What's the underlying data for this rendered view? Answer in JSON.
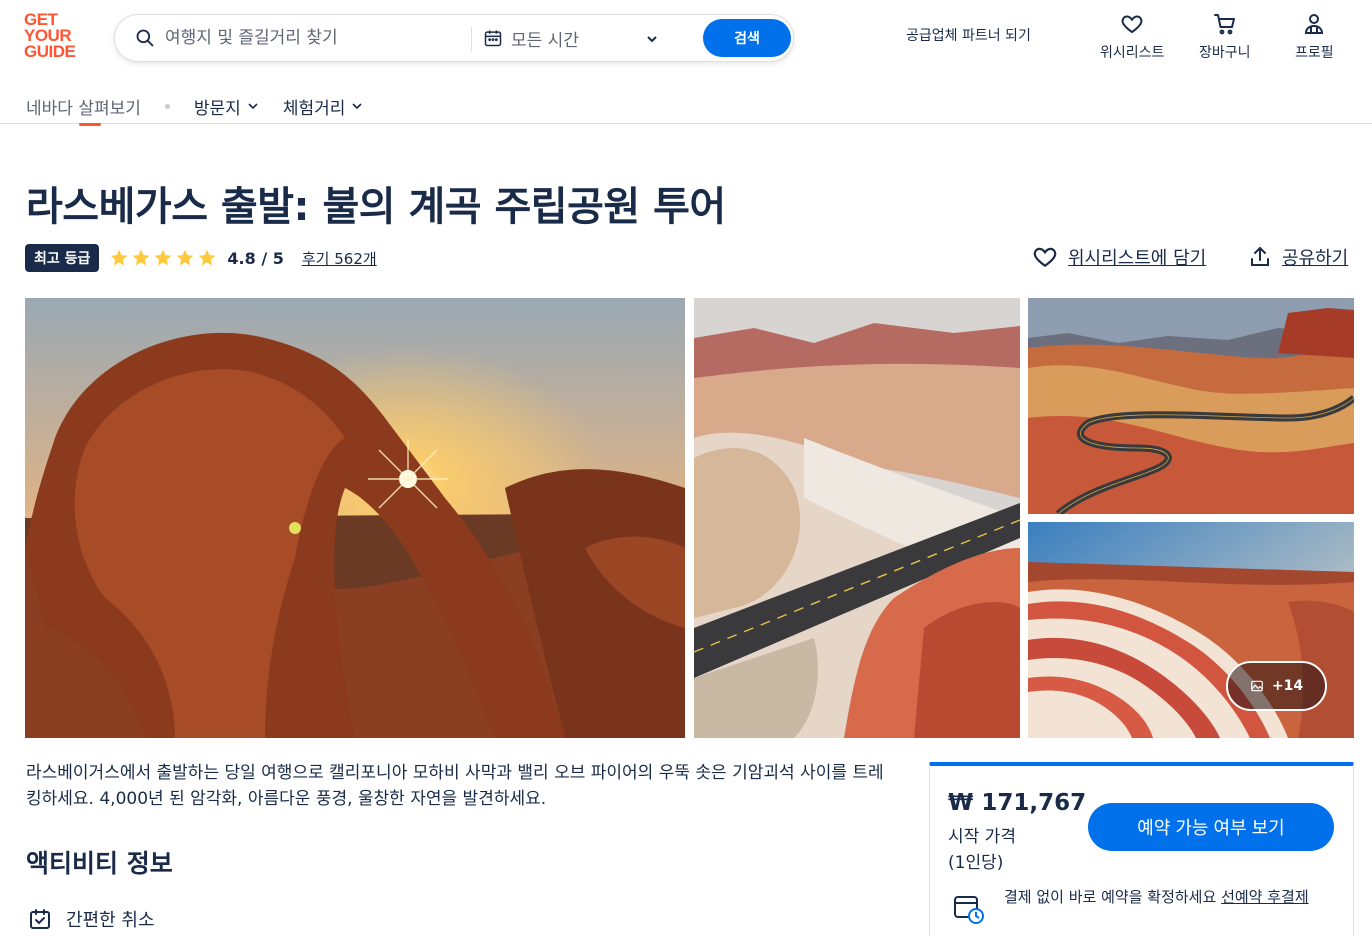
{
  "header": {
    "logo_lines": [
      "GET",
      "YOUR",
      "GUIDE"
    ],
    "search_placeholder": "여행지 및 즐길거리 찾기",
    "date_label": "모든 시간",
    "search_button": "검색",
    "partner_link": "공급업체 파트너 되기",
    "wishlist_label": "위시리스트",
    "cart_label": "장바구니",
    "profile_label": "프로필"
  },
  "subnav": {
    "explore": "네바다 살펴보기",
    "places": "방문지",
    "experiences": "체험거리"
  },
  "activity": {
    "title": "라스베가스 출발: 불의 계곡 주립공원 투어",
    "badge": "최고 등급",
    "rating": "4.8 / 5",
    "reviews": "후기 562개",
    "add_wishlist": "위시리스트에 담기",
    "share": "공유하기",
    "more_photos": "+14",
    "description": "라스베이거스에서 출발하는 당일 여행으로 캘리포니아 모하비 사막과 밸리 오브 파이어의 우뚝 솟은 기암괴석 사이를 트레킹하세요. 4,000년 된 암각화, 아름다운 풍경, 울창한 자연을 발견하세요.",
    "info_title": "액티비티 정보",
    "cancel_label": "간편한 취소"
  },
  "booking": {
    "price": "₩ 171,767",
    "from_label": "시작 가격",
    "per_person": "(1인당)",
    "button": "예약 가능 여부 보기",
    "note_text": "결제 없이 바로 예약을 확정하세요",
    "note_link": "선예약 후결제"
  },
  "colors": {
    "brand": "#ff5533",
    "primary": "#0071eb",
    "navy": "#1a2b49",
    "star": "#ffc83d"
  }
}
